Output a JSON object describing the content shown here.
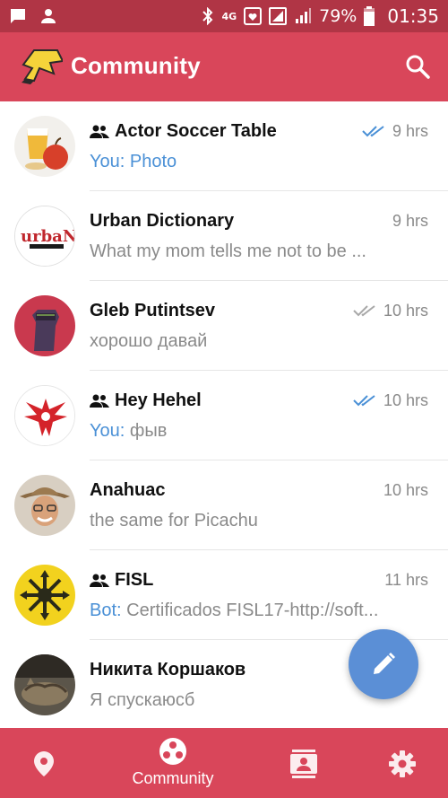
{
  "status_bar": {
    "battery": "79%",
    "time": "01:35",
    "network": "4G"
  },
  "app_bar": {
    "title": "Community"
  },
  "chats": [
    {
      "name": "Actor Soccer Table",
      "is_group": true,
      "time": "9 hrs",
      "read_state": "read",
      "sender": "You:",
      "message": "Photo"
    },
    {
      "name": "Urban Dictionary",
      "is_group": false,
      "time": "9 hrs",
      "read_state": "none",
      "sender": "",
      "message": "What my mom tells me not to be ..."
    },
    {
      "name": "Gleb Putintsev",
      "is_group": false,
      "time": "10 hrs",
      "read_state": "sent",
      "sender": "",
      "message": "хорошо давай"
    },
    {
      "name": "Hey Hehel",
      "is_group": true,
      "time": "10 hrs",
      "read_state": "read",
      "sender": "You:",
      "message": "фыв"
    },
    {
      "name": "Anahuac",
      "is_group": false,
      "time": "10 hrs",
      "read_state": "none",
      "sender": "",
      "message": "the same for Picachu"
    },
    {
      "name": "FISL",
      "is_group": true,
      "time": "11 hrs",
      "read_state": "none",
      "sender": "Bot:",
      "message": "Certificados FISL17-http://soft..."
    },
    {
      "name": "Никита Коршаков",
      "is_group": false,
      "time": "",
      "read_state": "none",
      "sender": "",
      "message": "Я спускаюсб"
    }
  ],
  "bottom_nav": {
    "items": [
      {
        "id": "location",
        "label": "",
        "icon": "location-pin-icon"
      },
      {
        "id": "community",
        "label": "Community",
        "icon": "community-icon"
      },
      {
        "id": "contacts",
        "label": "",
        "icon": "contacts-icon"
      },
      {
        "id": "settings",
        "label": "",
        "icon": "settings-gear-icon"
      }
    ],
    "active": "community"
  },
  "colors": {
    "status_bar": "#b03545",
    "primary": "#d9465a",
    "accent_blue": "#4a90d6",
    "fab": "#5b8fd6",
    "secondary_text": "#8a8a8a"
  }
}
